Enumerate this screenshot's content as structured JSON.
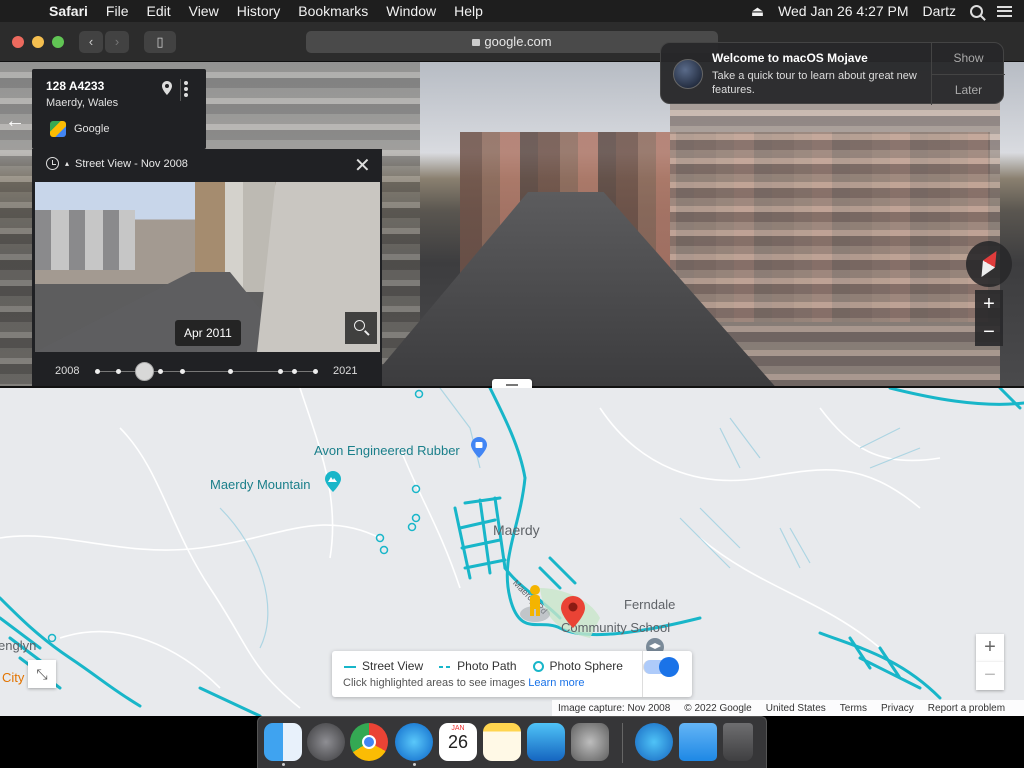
{
  "menubar": {
    "app": "Safari",
    "items": [
      "File",
      "Edit",
      "View",
      "History",
      "Bookmarks",
      "Window",
      "Help"
    ],
    "datetime": "Wed Jan 26  4:27 PM",
    "user": "Dartz"
  },
  "browser": {
    "url": "google.com"
  },
  "notification": {
    "title": "Welcome to macOS Mojave",
    "body": "Take a quick tour to learn about great new features.",
    "show": "Show",
    "later": "Later"
  },
  "address_card": {
    "road": "128 A4233",
    "place": "Maerdy, Wales",
    "provider": "Google"
  },
  "timeline": {
    "title": "Street View - Nov 2008",
    "preview_date": "Apr 2011",
    "start_year": "2008",
    "end_year": "2021",
    "selected_position": 0.22
  },
  "map": {
    "labels": {
      "avon": "Avon Engineered Rubber",
      "mountain": "Maerdy Mountain",
      "maerdy": "Maerdy",
      "ferndale": "Ferndale",
      "school": "Community School",
      "englyn": "englyn",
      "city": "City",
      "road": "Maerdy Rd"
    },
    "legend": {
      "street_view": "Street View",
      "photo_path": "Photo Path",
      "photo_sphere": "Photo Sphere",
      "hint": "Click highlighted areas to see images",
      "learn_more": "Learn more"
    },
    "footer": {
      "capture": "Image capture: Nov 2008",
      "copyright": "© 2022 Google",
      "country": "United States",
      "terms": "Terms",
      "privacy": "Privacy",
      "report": "Report a problem"
    },
    "colors": {
      "coverage": "#18b6c9",
      "pin": "#ea4335",
      "pegman": "#f4b400"
    }
  },
  "dock": {
    "apps": [
      "finder-icon",
      "launchpad-icon",
      "chrome-icon",
      "safari-icon",
      "calendar-icon",
      "notes-icon",
      "app-store-icon",
      "system-preferences-icon",
      "app-store-folder-icon",
      "downloads-folder-icon",
      "trash-icon"
    ],
    "calendar_month": "JAN",
    "calendar_day": "26"
  }
}
